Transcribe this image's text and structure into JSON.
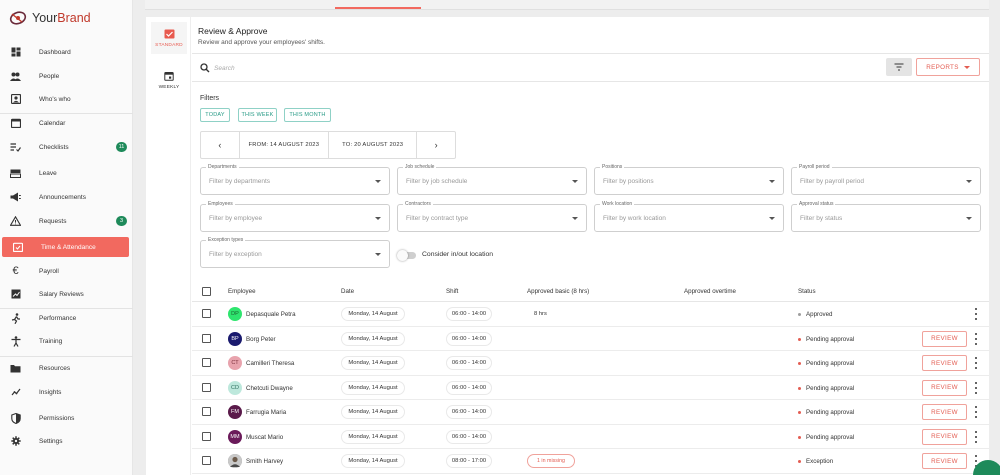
{
  "brand": {
    "prefix": "Your",
    "suffix": "Brand"
  },
  "sidebar": {
    "items": [
      {
        "label": "Dashboard",
        "icon": "dashboard-icon"
      },
      {
        "label": "People",
        "icon": "people-icon"
      },
      {
        "label": "Who's who",
        "icon": "contact-card-icon"
      },
      {
        "label": "Calendar",
        "icon": "calendar-icon"
      },
      {
        "label": "Checklists",
        "icon": "checklist-icon",
        "badge": "11"
      },
      {
        "label": "Leave",
        "icon": "leave-icon"
      },
      {
        "label": "Announcements",
        "icon": "megaphone-icon"
      },
      {
        "label": "Requests",
        "icon": "warning-icon",
        "badge": "3"
      },
      {
        "label": "Time & Attendance",
        "icon": "calendar-clock-icon",
        "active": true
      },
      {
        "label": "Payroll",
        "icon": "euro-icon"
      },
      {
        "label": "Salary Reviews",
        "icon": "trending-icon"
      },
      {
        "label": "Performance",
        "icon": "running-icon"
      },
      {
        "label": "Training",
        "icon": "training-icon"
      },
      {
        "label": "Resources",
        "icon": "folder-icon"
      },
      {
        "label": "Insights",
        "icon": "insights-icon"
      },
      {
        "label": "Permissions",
        "icon": "shield-icon"
      },
      {
        "label": "Settings",
        "icon": "gear-icon"
      }
    ]
  },
  "subnav": {
    "standard": "STANDARD",
    "weekly": "WEEKLY"
  },
  "header": {
    "title": "Review & Approve",
    "subtitle": "Review and approve your employees' shifts."
  },
  "search": {
    "placeholder": "Search"
  },
  "toolbar": {
    "reports_label": "REPORTS"
  },
  "filters": {
    "label": "Filters",
    "chips": [
      "TODAY",
      "THIS WEEK",
      "THIS MONTH"
    ],
    "from_label": "FROM: 14 AUGUST 2023",
    "to_label": "TO: 20 AUGUST 2023",
    "fields": [
      {
        "label": "Departments",
        "placeholder": "Filter by departments"
      },
      {
        "label": "Job schedule",
        "placeholder": "Filter by job schedule"
      },
      {
        "label": "Positions",
        "placeholder": "Filter by positions"
      },
      {
        "label": "Payroll period",
        "placeholder": "Filter by payroll period"
      },
      {
        "label": "Employees",
        "placeholder": "Filter by employee"
      },
      {
        "label": "Contractors",
        "placeholder": "Filter by contract type"
      },
      {
        "label": "Work location",
        "placeholder": "Filter by work location"
      },
      {
        "label": "Approval status",
        "placeholder": "Filter by status"
      },
      {
        "label": "Exception types",
        "placeholder": "Filter by exception"
      }
    ],
    "toggle_label": "Consider in/out location"
  },
  "table": {
    "headers": [
      "Employee",
      "Date",
      "Shift",
      "Approved basic (8 hrs)",
      "Approved overtime",
      "Status"
    ],
    "review_label": "REVIEW",
    "rows": [
      {
        "initials": "DP",
        "name": "Depasquale Petra",
        "date": "Monday, 14 August",
        "shift": "06:00 - 14:00",
        "basic": "8 hrs",
        "status": "Approved",
        "status_color": "#9e9e9e",
        "avatar_bg": "#2ee56e",
        "avatar_fg": "#1a5e2e",
        "review": false
      },
      {
        "initials": "BP",
        "name": "Borg Peter",
        "date": "Monday, 14 August",
        "shift": "06:00 - 14:00",
        "basic": "",
        "status": "Pending approval",
        "status_color": "#e35d52",
        "avatar_bg": "#1a1a6e",
        "avatar_fg": "#ffffff",
        "review": true
      },
      {
        "initials": "CT",
        "name": "Camilleri Theresa",
        "date": "Monday, 14 August",
        "shift": "06:00 - 14:00",
        "basic": "",
        "status": "Pending approval",
        "status_color": "#e35d52",
        "avatar_bg": "#e8a3ad",
        "avatar_fg": "#7a2e3a",
        "review": true
      },
      {
        "initials": "CD",
        "name": "Chetcuti Dwayne",
        "date": "Monday, 14 August",
        "shift": "06:00 - 14:00",
        "basic": "",
        "status": "Pending approval",
        "status_color": "#e35d52",
        "avatar_bg": "#bde8dc",
        "avatar_fg": "#2e6e5e",
        "review": true
      },
      {
        "initials": "FM",
        "name": "Farrugia Maria",
        "date": "Monday, 14 August",
        "shift": "06:00 - 14:00",
        "basic": "",
        "status": "Pending approval",
        "status_color": "#e35d52",
        "avatar_bg": "#5a1a4a",
        "avatar_fg": "#ffffff",
        "review": true
      },
      {
        "initials": "MM",
        "name": "Muscat Mario",
        "date": "Monday, 14 August",
        "shift": "06:00 - 14:00",
        "basic": "",
        "status": "Pending approval",
        "status_color": "#e35d52",
        "avatar_bg": "#6a1a5a",
        "avatar_fg": "#ffffff",
        "review": true
      },
      {
        "initials": "",
        "name": "Smith Harvey",
        "date": "Monday, 14 August",
        "shift": "08:00 - 17:00",
        "basic": "",
        "missing": "1 in missing",
        "status": "Exception",
        "status_color": "#e35d52",
        "avatar_bg": "#8a8a8a",
        "avatar_fg": "#ffffff",
        "photo": true,
        "review": true
      }
    ]
  },
  "colors": {
    "accent": "#f2695f",
    "teal": "#279a86",
    "badge_green": "#1e8a5a"
  }
}
